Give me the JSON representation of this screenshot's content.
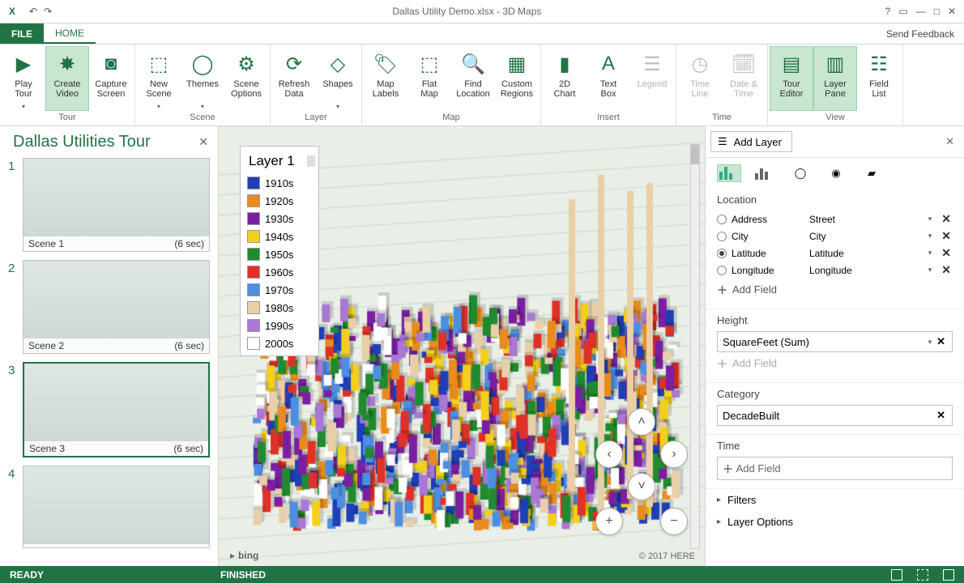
{
  "window": {
    "title": "Dallas Utility Demo.xlsx - 3D Maps",
    "help": "?",
    "feedback": "Send Feedback"
  },
  "tabs": {
    "file": "FILE",
    "home": "HOME"
  },
  "ribbon": {
    "groups": {
      "tour": {
        "label": "Tour",
        "play": "Play\nTour",
        "create": "Create\nVideo",
        "capture": "Capture\nScreen"
      },
      "scene": {
        "label": "Scene",
        "new": "New\nScene",
        "themes": "Themes",
        "options": "Scene\nOptions"
      },
      "layer": {
        "label": "Layer",
        "refresh": "Refresh\nData",
        "shapes": "Shapes"
      },
      "map": {
        "label": "Map",
        "labels": "Map\nLabels",
        "flat": "Flat\nMap",
        "find": "Find\nLocation",
        "custom": "Custom\nRegions"
      },
      "insert": {
        "label": "Insert",
        "chart": "2D\nChart",
        "textbox": "Text\nBox",
        "legend": "Legend"
      },
      "time": {
        "label": "Time",
        "timeline": "Time\nLine",
        "datetime": "Date &\nTime"
      },
      "view": {
        "label": "View",
        "toureditor": "Tour\nEditor",
        "layerpane": "Layer\nPane",
        "fieldlist": "Field\nList"
      }
    }
  },
  "tourPanel": {
    "title": "Dallas Utilities Tour",
    "scenes": [
      {
        "name": "Scene 1",
        "duration": "(6 sec)"
      },
      {
        "name": "Scene 2",
        "duration": "(6 sec)"
      },
      {
        "name": "Scene 3",
        "duration": "(6 sec)"
      },
      {
        "name": "",
        "duration": ""
      }
    ]
  },
  "legend": {
    "title": "Layer 1",
    "items": [
      {
        "label": "1910s",
        "color": "#1f3fb6"
      },
      {
        "label": "1920s",
        "color": "#e98b1d"
      },
      {
        "label": "1930s",
        "color": "#7b1fa2"
      },
      {
        "label": "1940s",
        "color": "#f2d01c"
      },
      {
        "label": "1950s",
        "color": "#1f8b2e"
      },
      {
        "label": "1960s",
        "color": "#e03127"
      },
      {
        "label": "1970s",
        "color": "#4c8fe2"
      },
      {
        "label": "1980s",
        "color": "#e9cfa8"
      },
      {
        "label": "1990s",
        "color": "#a977d4"
      },
      {
        "label": "2000s",
        "color": "#ffffff"
      }
    ]
  },
  "mapAttr": {
    "bing": "bing",
    "here": "© 2017 HERE"
  },
  "layerPanel": {
    "addLayer": "Add Layer",
    "location": {
      "heading": "Location",
      "rows": [
        {
          "field": "Address",
          "map": "Street",
          "selected": false
        },
        {
          "field": "City",
          "map": "City",
          "selected": false
        },
        {
          "field": "Latitude",
          "map": "Latitude",
          "selected": true
        },
        {
          "field": "Longitude",
          "map": "Longitude",
          "selected": false
        }
      ],
      "addField": "Add Field"
    },
    "height": {
      "heading": "Height",
      "value": "SquareFeet (Sum)",
      "addField": "Add Field"
    },
    "category": {
      "heading": "Category",
      "value": "DecadeBuilt"
    },
    "timeSec": {
      "heading": "Time",
      "addField": "Add Field"
    },
    "filters": "Filters",
    "layerOptions": "Layer Options"
  },
  "status": {
    "ready": "READY",
    "finished": "FINISHED"
  }
}
